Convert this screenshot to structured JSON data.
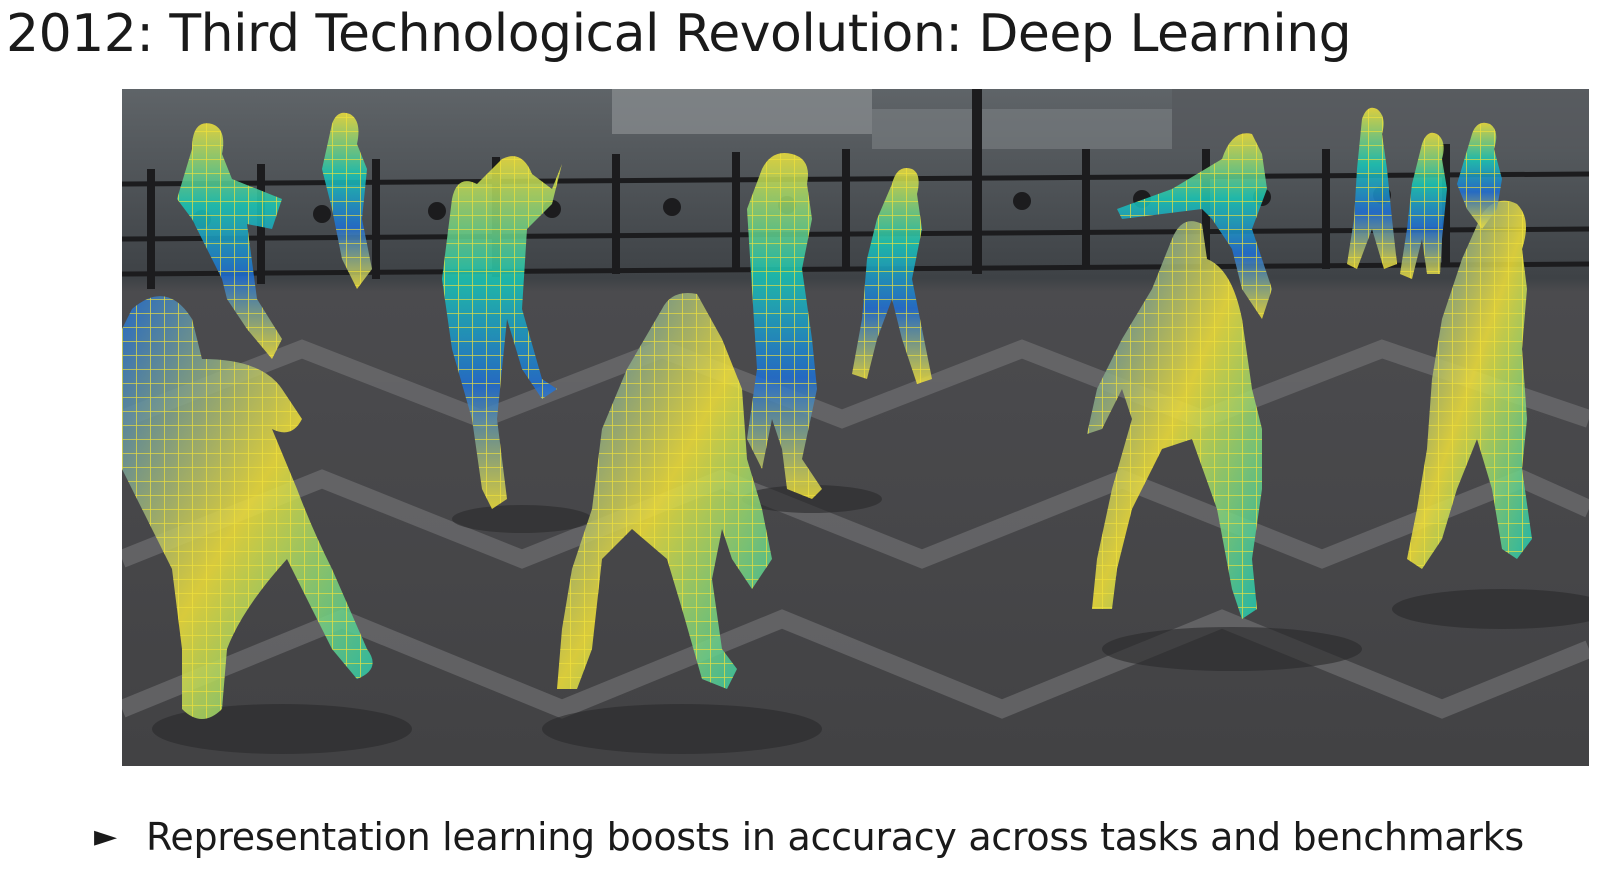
{
  "slide": {
    "title": "2012: Third Technological Revolution: Deep Learning",
    "bullets": [
      {
        "marker": "►",
        "text": "Representation learning boosts in accuracy across tasks and benchmarks"
      }
    ]
  },
  "figure": {
    "colors": {
      "pavement": "#4b4b4e",
      "pavement_pattern": "#7a7a7c",
      "background_water": "#6f7478",
      "railing": "#1c1c1e",
      "mesh_cool": "#1f6fd6",
      "mesh_mid": "#18c9b8",
      "mesh_warm": "#f2e23a"
    }
  }
}
